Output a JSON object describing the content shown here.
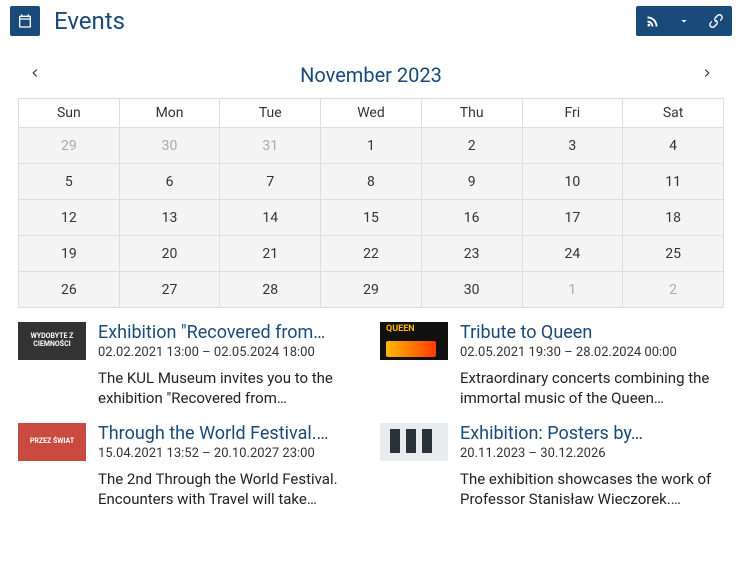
{
  "header": {
    "title": "Events"
  },
  "calendar": {
    "month_label": "November 2023",
    "weekdays": [
      "Sun",
      "Mon",
      "Tue",
      "Wed",
      "Thu",
      "Fri",
      "Sat"
    ],
    "weeks": [
      [
        {
          "d": "29",
          "o": true
        },
        {
          "d": "30",
          "o": true
        },
        {
          "d": "31",
          "o": true
        },
        {
          "d": "1"
        },
        {
          "d": "2"
        },
        {
          "d": "3"
        },
        {
          "d": "4"
        }
      ],
      [
        {
          "d": "5"
        },
        {
          "d": "6"
        },
        {
          "d": "7"
        },
        {
          "d": "8"
        },
        {
          "d": "9"
        },
        {
          "d": "10"
        },
        {
          "d": "11"
        }
      ],
      [
        {
          "d": "12"
        },
        {
          "d": "13"
        },
        {
          "d": "14"
        },
        {
          "d": "15"
        },
        {
          "d": "16"
        },
        {
          "d": "17"
        },
        {
          "d": "18"
        }
      ],
      [
        {
          "d": "19"
        },
        {
          "d": "20"
        },
        {
          "d": "21"
        },
        {
          "d": "22"
        },
        {
          "d": "23"
        },
        {
          "d": "24"
        },
        {
          "d": "25"
        }
      ],
      [
        {
          "d": "26"
        },
        {
          "d": "27"
        },
        {
          "d": "28"
        },
        {
          "d": "29"
        },
        {
          "d": "30"
        },
        {
          "d": "1",
          "o": true
        },
        {
          "d": "2",
          "o": true
        }
      ]
    ]
  },
  "events": [
    {
      "title": "Exhibition \"Recovered from…",
      "date": "02.02.2021 13:00 – 02.05.2024 18:00",
      "desc": "The KUL Museum invites you to the exhibition \"Recovered from…",
      "thumb_label": "WYDOBYTE\nZ CIEMNOŚCI",
      "thumb_class": ""
    },
    {
      "title": "Tribute to Queen",
      "date": "02.05.2021 19:30 – 28.02.2024 00:00",
      "desc": "Extraordinary concerts combining the immortal music of the Queen…",
      "thumb_label": "",
      "thumb_class": "queen"
    },
    {
      "title": "Through the World Festival.…",
      "date": "15.04.2021 13:52 – 20.10.2027 23:00",
      "desc": "The 2nd Through the World Festival. Encounters with Travel will take…",
      "thumb_label": "PRZEZ ŚWIAT",
      "thumb_class": "red"
    },
    {
      "title": "Exhibition: Posters by…",
      "date": "20.11.2023 – 30.12.2026",
      "desc": "The exhibition showcases the work of Professor Stanisław Wieczorek.…",
      "thumb_label": "",
      "thumb_class": "posters"
    }
  ]
}
